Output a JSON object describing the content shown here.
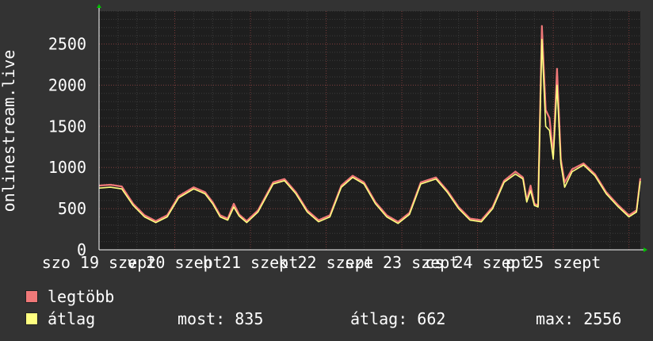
{
  "chart_data": {
    "type": "line",
    "ylabel": "onlinestream.live",
    "ylim": [
      0,
      2900
    ],
    "yticks": [
      0,
      500,
      1000,
      1500,
      2000,
      2500
    ],
    "xlim": [
      0,
      7.15
    ],
    "x_ticks": [
      {
        "x": 0.0,
        "label": "szo 19 szept"
      },
      {
        "x": 1.0,
        "label": "v 20 szept"
      },
      {
        "x": 2.0,
        "label": "h 21 szept"
      },
      {
        "x": 3.0,
        "label": "k 22 szept"
      },
      {
        "x": 4.0,
        "label": "sze 23 szept"
      },
      {
        "x": 5.0,
        "label": "cs 24 szept"
      },
      {
        "x": 6.0,
        "label": "p 25 szept"
      }
    ],
    "grid": true,
    "series": [
      {
        "name": "legtöbb",
        "color": "#f07878",
        "points": [
          [
            0.0,
            780
          ],
          [
            0.15,
            790
          ],
          [
            0.3,
            770
          ],
          [
            0.45,
            560
          ],
          [
            0.6,
            420
          ],
          [
            0.75,
            350
          ],
          [
            0.9,
            420
          ],
          [
            1.05,
            650
          ],
          [
            1.25,
            760
          ],
          [
            1.4,
            700
          ],
          [
            1.5,
            580
          ],
          [
            1.6,
            420
          ],
          [
            1.7,
            380
          ],
          [
            1.78,
            560
          ],
          [
            1.85,
            430
          ],
          [
            1.95,
            350
          ],
          [
            2.1,
            480
          ],
          [
            2.3,
            820
          ],
          [
            2.45,
            860
          ],
          [
            2.6,
            700
          ],
          [
            2.75,
            480
          ],
          [
            2.9,
            360
          ],
          [
            3.05,
            420
          ],
          [
            3.2,
            780
          ],
          [
            3.35,
            900
          ],
          [
            3.5,
            820
          ],
          [
            3.65,
            580
          ],
          [
            3.8,
            420
          ],
          [
            3.95,
            340
          ],
          [
            4.1,
            450
          ],
          [
            4.25,
            820
          ],
          [
            4.45,
            880
          ],
          [
            4.6,
            720
          ],
          [
            4.75,
            520
          ],
          [
            4.9,
            380
          ],
          [
            5.05,
            360
          ],
          [
            5.2,
            520
          ],
          [
            5.35,
            840
          ],
          [
            5.5,
            950
          ],
          [
            5.6,
            880
          ],
          [
            5.65,
            600
          ],
          [
            5.7,
            780
          ],
          [
            5.75,
            560
          ],
          [
            5.8,
            540
          ],
          [
            5.85,
            2720
          ],
          [
            5.9,
            1700
          ],
          [
            5.95,
            1600
          ],
          [
            6.0,
            1150
          ],
          [
            6.05,
            2200
          ],
          [
            6.1,
            1100
          ],
          [
            6.15,
            820
          ],
          [
            6.25,
            980
          ],
          [
            6.4,
            1050
          ],
          [
            6.55,
            920
          ],
          [
            6.7,
            700
          ],
          [
            6.85,
            550
          ],
          [
            7.0,
            420
          ],
          [
            7.1,
            480
          ],
          [
            7.15,
            870
          ]
        ]
      },
      {
        "name": "átlag",
        "color": "#ffff80",
        "points": [
          [
            0.0,
            750
          ],
          [
            0.15,
            760
          ],
          [
            0.3,
            740
          ],
          [
            0.45,
            540
          ],
          [
            0.6,
            400
          ],
          [
            0.75,
            330
          ],
          [
            0.9,
            400
          ],
          [
            1.05,
            630
          ],
          [
            1.25,
            740
          ],
          [
            1.4,
            680
          ],
          [
            1.5,
            560
          ],
          [
            1.6,
            400
          ],
          [
            1.7,
            360
          ],
          [
            1.78,
            520
          ],
          [
            1.85,
            410
          ],
          [
            1.95,
            330
          ],
          [
            2.1,
            460
          ],
          [
            2.3,
            800
          ],
          [
            2.45,
            840
          ],
          [
            2.6,
            680
          ],
          [
            2.75,
            460
          ],
          [
            2.9,
            340
          ],
          [
            3.05,
            400
          ],
          [
            3.2,
            760
          ],
          [
            3.35,
            880
          ],
          [
            3.5,
            800
          ],
          [
            3.65,
            560
          ],
          [
            3.8,
            400
          ],
          [
            3.95,
            320
          ],
          [
            4.1,
            430
          ],
          [
            4.25,
            800
          ],
          [
            4.45,
            860
          ],
          [
            4.6,
            700
          ],
          [
            4.75,
            500
          ],
          [
            4.9,
            360
          ],
          [
            5.05,
            340
          ],
          [
            5.2,
            500
          ],
          [
            5.35,
            820
          ],
          [
            5.5,
            920
          ],
          [
            5.6,
            860
          ],
          [
            5.65,
            580
          ],
          [
            5.7,
            720
          ],
          [
            5.75,
            540
          ],
          [
            5.8,
            520
          ],
          [
            5.85,
            2556
          ],
          [
            5.9,
            1500
          ],
          [
            5.95,
            1450
          ],
          [
            6.0,
            1100
          ],
          [
            6.05,
            2000
          ],
          [
            6.1,
            1050
          ],
          [
            6.15,
            760
          ],
          [
            6.25,
            950
          ],
          [
            6.4,
            1030
          ],
          [
            6.55,
            900
          ],
          [
            6.7,
            680
          ],
          [
            6.85,
            530
          ],
          [
            7.0,
            400
          ],
          [
            7.1,
            460
          ],
          [
            7.15,
            835
          ]
        ]
      }
    ]
  },
  "legend": {
    "max_label": "legtöbb",
    "avg_label": "átlag",
    "now_text": "most: 835",
    "avg_text": "átlag: 662",
    "max_text": "max: 2556",
    "max_color": "#f07878",
    "avg_color": "#ffff80"
  }
}
